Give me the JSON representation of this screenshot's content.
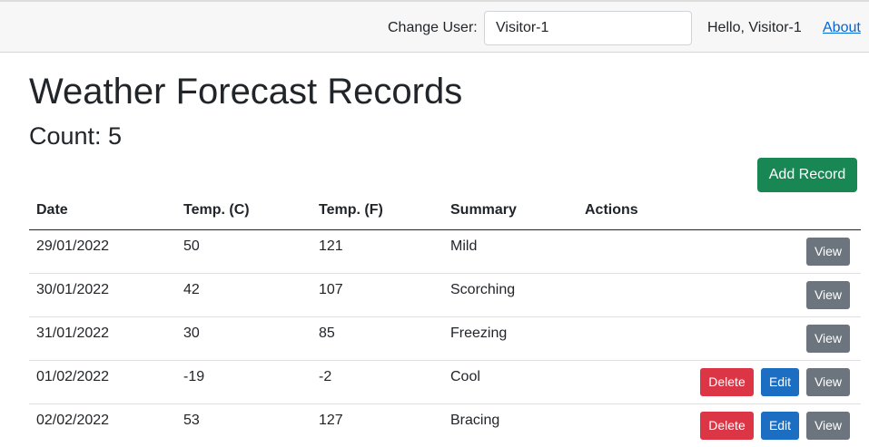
{
  "header": {
    "change_user_label": "Change User:",
    "user_input_value": "Visitor-1",
    "greeting": "Hello, Visitor-1",
    "about_link": "About"
  },
  "main": {
    "title": "Weather Forecast Records",
    "count_text": "Count: 5",
    "add_button": "Add Record"
  },
  "table": {
    "headers": [
      "Date",
      "Temp. (C)",
      "Temp. (F)",
      "Summary",
      "Actions"
    ],
    "rows": [
      {
        "date": "29/01/2022",
        "temp_c": "50",
        "temp_f": "121",
        "summary": "Mild",
        "actions": [
          "View"
        ]
      },
      {
        "date": "30/01/2022",
        "temp_c": "42",
        "temp_f": "107",
        "summary": "Scorching",
        "actions": [
          "View"
        ]
      },
      {
        "date": "31/01/2022",
        "temp_c": "30",
        "temp_f": "85",
        "summary": "Freezing",
        "actions": [
          "View"
        ]
      },
      {
        "date": "01/02/2022",
        "temp_c": "-19",
        "temp_f": "-2",
        "summary": "Cool",
        "actions": [
          "Delete",
          "Edit",
          "View"
        ]
      },
      {
        "date": "02/02/2022",
        "temp_c": "53",
        "temp_f": "127",
        "summary": "Bracing",
        "actions": [
          "Delete",
          "Edit",
          "View"
        ]
      }
    ]
  },
  "colors": {
    "add_button": "#198754",
    "view_button": "#6c757d",
    "edit_button": "#1b6ec2",
    "delete_button": "#dc3545",
    "link": "#0366d6"
  }
}
